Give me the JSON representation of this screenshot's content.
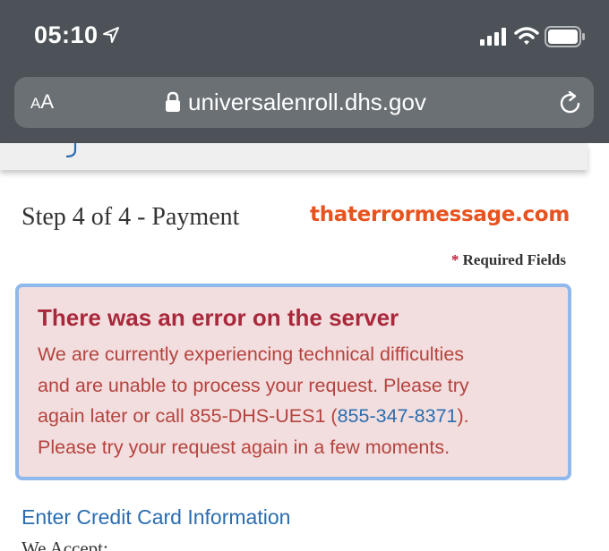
{
  "status_bar": {
    "time": "05:10",
    "icons": [
      "location-arrow-icon",
      "cellular-signal-icon",
      "wifi-icon",
      "battery-icon"
    ]
  },
  "address_bar": {
    "text_size_label_small": "A",
    "text_size_label_large": "A",
    "url": "universalenroll.dhs.gov",
    "icons": [
      "lock-icon",
      "reload-icon"
    ]
  },
  "page": {
    "step_title": "Step 4 of 4 - Payment",
    "watermark": "thaterrormessage.com",
    "required_asterisk": "*",
    "required_label": "Required Fields",
    "error": {
      "heading": "There was an error on the server",
      "line1": "We are currently experiencing technical difficulties",
      "line2": "and are unable to process your request. Please try",
      "line3_pre": "again later or call 855-DHS-UES1 (",
      "phone_link": "855-347-8371",
      "line3_post": ").",
      "line4": "Please try your request again in a few moments."
    },
    "cc_heading": "Enter Credit Card Information",
    "we_accept": "We Accept:"
  },
  "colors": {
    "chrome_bg": "#4c5257",
    "address_bar_bg": "#6b7075",
    "error_bg": "#f2dede",
    "error_border": "#8fb8ec",
    "error_heading": "#a9283c",
    "error_text": "#b5433f",
    "link": "#2a6db0",
    "watermark": "#e8521e"
  }
}
